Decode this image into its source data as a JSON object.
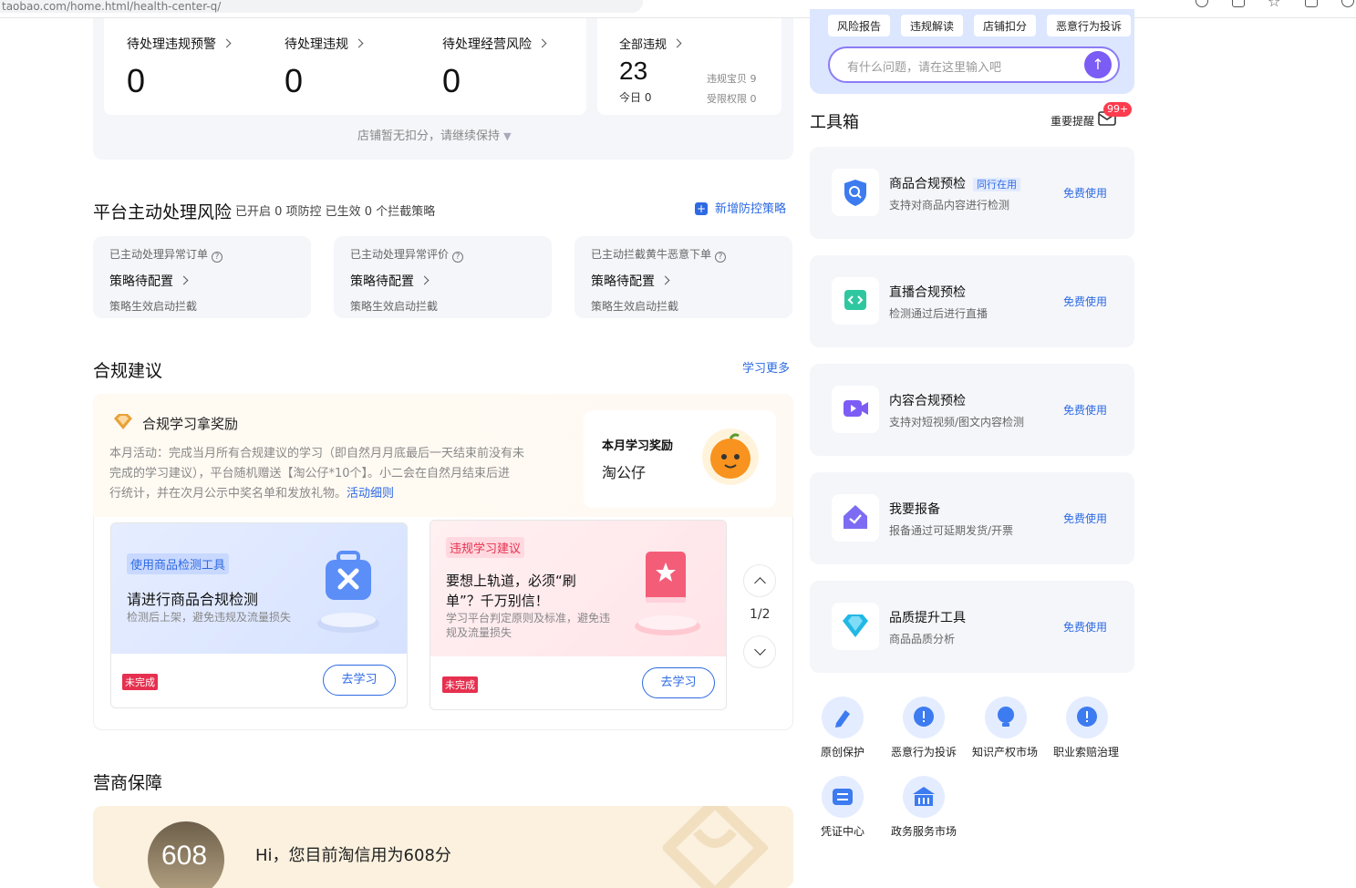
{
  "browser": {
    "url": "taobao.com/home.html/health-center-q/"
  },
  "summary": {
    "pending_warning_label": "待处理违规预警",
    "pending_warning_value": "0",
    "pending_violation_label": "待处理违规",
    "pending_violation_value": "0",
    "pending_risk_label": "待处理经营风险",
    "pending_risk_value": "0",
    "all_label": "全部违规",
    "all_value": "23",
    "today_label": "今日 0",
    "item_violation_label": "违规宝贝 9",
    "restricted_label": "受限权限 0",
    "footer_note": "店铺暂无扣分，请继续保持"
  },
  "platform_risk": {
    "title": "平台主动处理风险",
    "subtitle": "已开启 0 项防控 已生效 0 个拦截策略",
    "add_label": "新增防控策略",
    "cards": [
      {
        "label": "已主动处理异常订单",
        "status": "策略待配置",
        "note": "策略生效启动拦截"
      },
      {
        "label": "已主动处理异常评价",
        "status": "策略待配置",
        "note": "策略生效启动拦截"
      },
      {
        "label": "已主动拦截黄牛恶意下单",
        "status": "策略待配置",
        "note": "策略生效启动拦截"
      }
    ]
  },
  "compliance": {
    "title": "合规建议",
    "more_label": "学习更多",
    "banner_title": "合规学习拿奖励",
    "banner_line1": "本月活动：完成当月所有合规建议的学习（即自然月月底最后一天结束前没有未",
    "banner_line2": "完成的学习建议），平台随机赠送【淘公仔*10个】。小二会在自然月结束后进",
    "banner_line3": "行统计，并在次月公示中奖名单和发放礼物。",
    "banner_link": "活动细则",
    "reward_label": "本月学习奖励",
    "reward_value": "淘公仔",
    "cards": [
      {
        "tag": "使用商品检测工具",
        "title": "请进行商品合规检测",
        "desc": "检测后上架，避免违规及流量损失",
        "status": "未完成",
        "button": "去学习"
      },
      {
        "tag": "违规学习建议",
        "title_line1": "要想上轨道，必须“刷",
        "title_line2": "单”？千万别信！",
        "desc_line1": "学习平台判定原则及标准，避免违",
        "desc_line2": "规及流量损失",
        "status": "未完成",
        "button": "去学习"
      }
    ],
    "pager": "1/2"
  },
  "guarantee": {
    "title": "营商保障",
    "score": "608",
    "greeting": "Hi，您目前淘信用为608分"
  },
  "assistant": {
    "tags": [
      "风险报告",
      "违规解读",
      "店铺扣分",
      "恶意行为投诉"
    ],
    "placeholder": "有什么问题，请在这里输入吧"
  },
  "toolbox": {
    "title": "工具箱",
    "notice_label": "重要提醒",
    "notice_badge": "99+",
    "tools": [
      {
        "name": "商品合规预检",
        "badge": "同行在用",
        "desc": "支持对商品内容进行检测",
        "button": "免费使用",
        "icon": "shield-search-icon"
      },
      {
        "name": "直播合规预检",
        "desc": "检测通过后进行直播",
        "button": "免费使用",
        "icon": "code-icon"
      },
      {
        "name": "内容合规预检",
        "desc": "支持对短视频/图文内容检测",
        "button": "免费使用",
        "icon": "video-icon"
      },
      {
        "name": "我要报备",
        "desc": "报备通过可延期发货/开票",
        "button": "免费使用",
        "icon": "report-icon"
      },
      {
        "name": "品质提升工具",
        "desc": "商品品质分析",
        "button": "免费使用",
        "icon": "diamond-icon"
      }
    ],
    "services": [
      "原创保护",
      "恶意行为投诉",
      "知识产权市场",
      "职业索赔治理",
      "凭证中心",
      "政务服务市场"
    ]
  },
  "colors": {
    "accent": "#2d6ae3",
    "purple": "#7b5cf5",
    "danger": "#e6304f"
  }
}
